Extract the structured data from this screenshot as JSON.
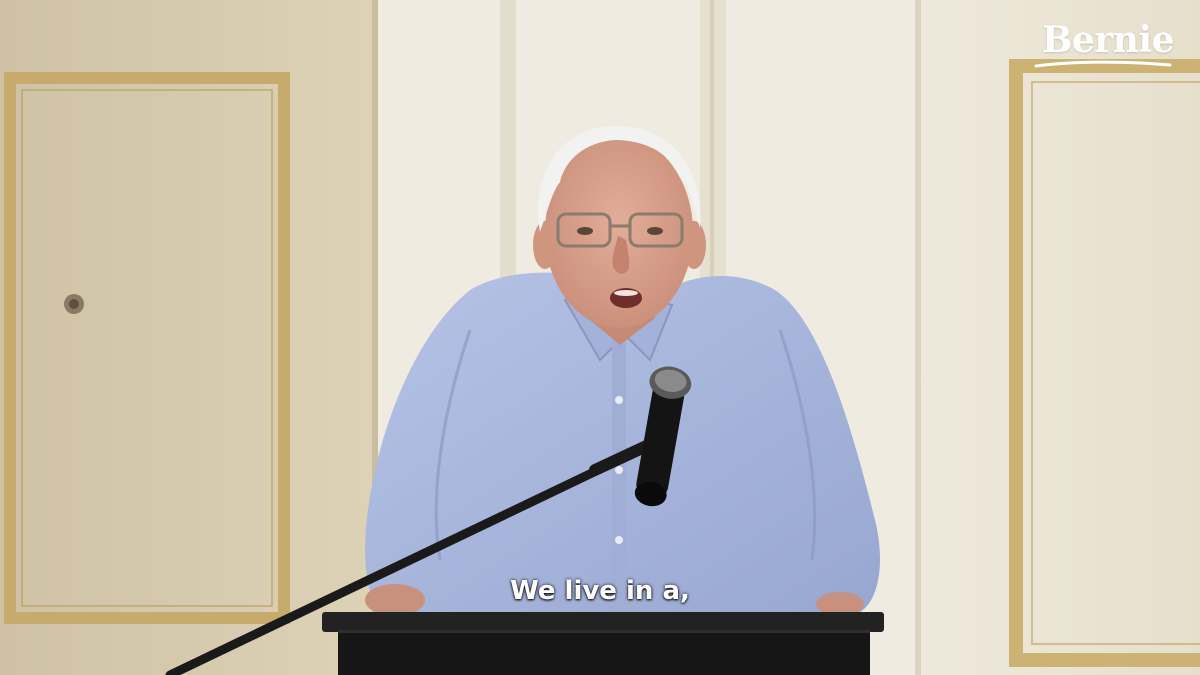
{
  "video": {
    "watermark": "Bernie",
    "caption": "We live in a,"
  },
  "colors": {
    "wall_left": "#d8ccb0",
    "wall_right": "#ece6d6",
    "frame_gold": "#c8ae6c",
    "shirt": "#a9b7dc",
    "skin": "#d9a38f",
    "hair": "#eeeeee",
    "podium": "#1f1f1f",
    "caption_text": "#ffffff"
  }
}
